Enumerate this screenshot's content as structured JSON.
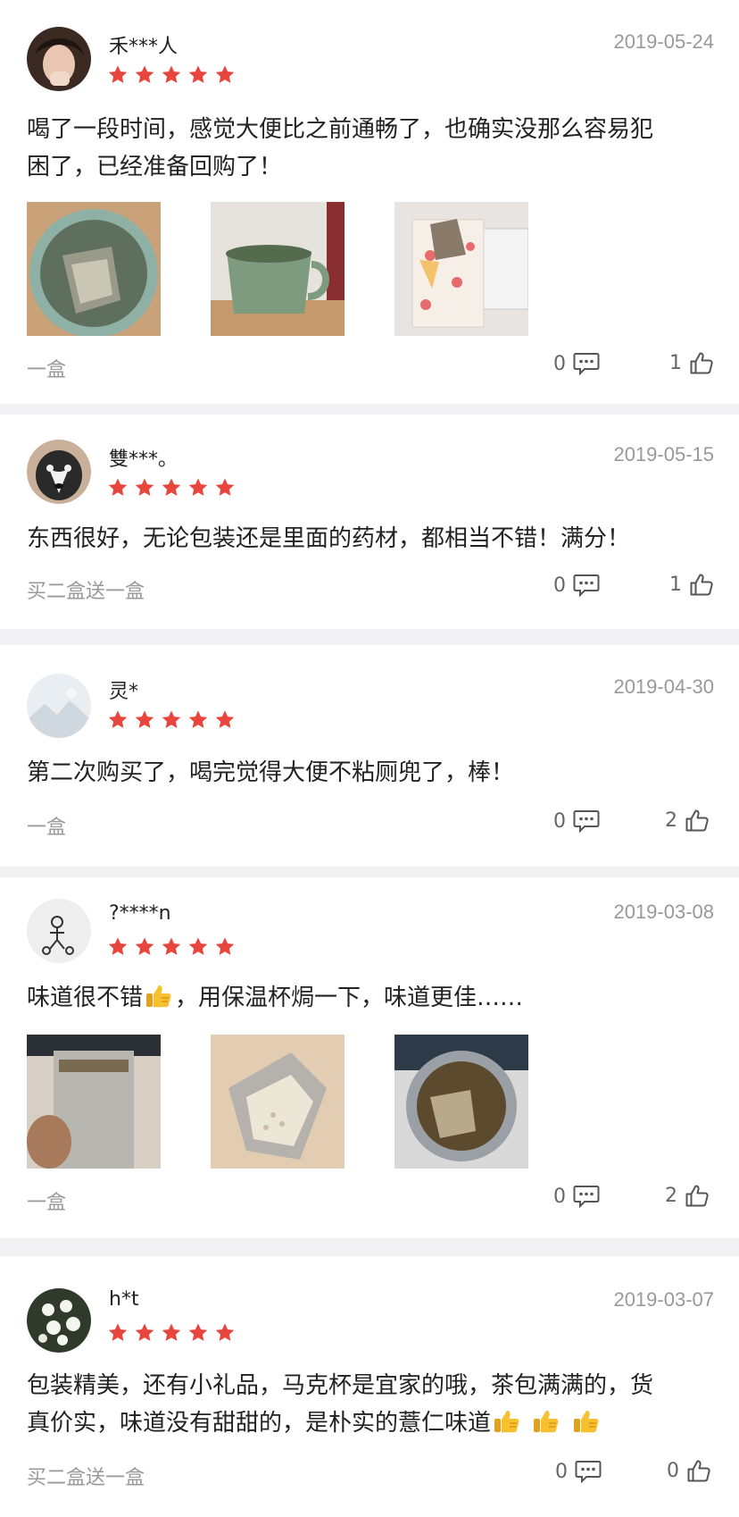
{
  "star_color": "#e8453c",
  "reviews": [
    {
      "user": "禾***人",
      "date": "2019-05-24",
      "rating": 5,
      "text_line1": "喝了一段时间，感觉大便比之前通畅了，也确实没那么容易犯",
      "text_line2": "困了，已经准备回购了！",
      "variant": "一盒",
      "comments": "0",
      "likes": "1"
    },
    {
      "user": "雙***。",
      "date": "2019-05-15",
      "rating": 5,
      "text_line1": "东西很好，无论包装还是里面的药材，都相当不错！满分！",
      "variant": "买二盒送一盒",
      "comments": "0",
      "likes": "1"
    },
    {
      "user": "灵*",
      "date": "2019-04-30",
      "rating": 5,
      "text_line1": "第二次购买了，喝完觉得大便不粘厕兜了，棒！",
      "variant": "一盒",
      "comments": "0",
      "likes": "2"
    },
    {
      "user": "?****n",
      "date": "2019-03-08",
      "rating": 5,
      "text_a": "味道很不错",
      "text_b": "，用保温杯焗一下，味道更佳……",
      "variant": "一盒",
      "comments": "0",
      "likes": "2"
    },
    {
      "user": "h*t",
      "date": "2019-03-07",
      "rating": 5,
      "text_line1": "包装精美，还有小礼品，马克杯是宜家的哦，茶包满满的，货",
      "text_line2": "真价实，味道没有甜甜的，是朴实的薏仁味道",
      "variant": "买二盒送一盒",
      "comments": "0",
      "likes": "0"
    }
  ]
}
